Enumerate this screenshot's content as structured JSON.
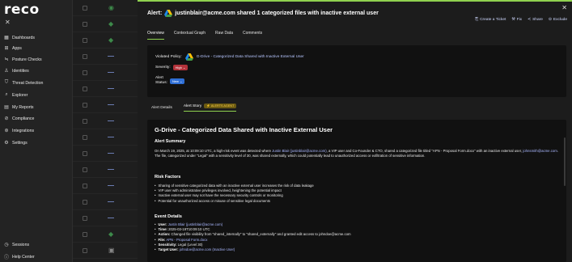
{
  "sidebar": {
    "logo": "reco",
    "items": [
      {
        "label": "Dashboards",
        "icon": "grid-icon"
      },
      {
        "label": "Apps",
        "icon": "apps-icon"
      },
      {
        "label": "Posture Checks",
        "icon": "posture-icon"
      },
      {
        "label": "Identities",
        "icon": "user-icon"
      },
      {
        "label": "Threat Detection",
        "icon": "shield-icon"
      },
      {
        "label": "Explorer",
        "icon": "explorer-icon"
      },
      {
        "label": "My Reports",
        "icon": "report-icon"
      },
      {
        "label": "Compliance",
        "icon": "check-icon"
      },
      {
        "label": "Integrations",
        "icon": "integration-icon"
      },
      {
        "label": "Settings",
        "icon": "gear-icon"
      }
    ],
    "bottom": [
      {
        "label": "Sessions",
        "icon": "clock-icon"
      },
      {
        "label": "Help Center",
        "icon": "help-icon"
      }
    ]
  },
  "alert": {
    "title_prefix": "Alert:",
    "title_text": "justinblair@acme.com shared 1 categorized files with inactive external user",
    "actions": [
      "Create a Ticket",
      "Fix",
      "Share",
      "Exclude"
    ],
    "tabs": [
      "Overview",
      "Contextual Graph",
      "Raw Data",
      "Comments"
    ],
    "violated_policy_label": "Violated Policy:",
    "violated_policy_value": "G-Drive - Categorized Data Shared with Inactive External User",
    "severity_label": "Severity:",
    "severity_value": "High",
    "status_label_1": "Alert",
    "status_label_2": "Status:",
    "status_value": "New",
    "subtabs": [
      "Alert Details",
      "Alert Story"
    ],
    "subtab_badge": "ALERTS AGENT"
  },
  "story": {
    "heading": "G-Drive - Categorized Data Shared with Inactive External User",
    "summary_title": "Alert Summary",
    "summary_1": "On March 19, 2025, at 10:09:10 UTC, a high-risk event was detected where ",
    "summary_user": "Justin Blair (justinblair@acme.com)",
    "summary_2": ", a VIP user and Co-Founder & CTO, shared a categorized file titled \"APN - Proposal Form.docx\" with an inactive external user, ",
    "summary_ext": "johnsmith@acme.com",
    "summary_3": ". The file, categorized under \"Legal\" with a sensitivity level of 30, was shared externally, which could potentially lead to unauthorized access or exfiltration of sensitive information.",
    "risk_title": "Risk Factors",
    "risks": [
      "Sharing of sensitive categorized data with an inactive external user increases the risk of data leakage",
      "VIP user with administrative privileges involved, heightening the potential impact",
      "Inactive external user may not have the necessary security controls or monitoring",
      "Potential for unauthorized access or misuse of sensitive legal documents"
    ],
    "event_title": "Event Details",
    "events": [
      {
        "k": "User:",
        "v": "Justin Blair (justinblair@acme.com)",
        "hl": true
      },
      {
        "k": "Time:",
        "v": "2025-03-19T10:09:10 UTC",
        "hl": false
      },
      {
        "k": "Action:",
        "v": "Changed file visibility from \"shared_internally\" to \"shared_externally\" and granted edit access to johndoe@acme.com",
        "hl": false
      },
      {
        "k": "File:",
        "v": "APN - Proposal Form.docx",
        "hl": true
      },
      {
        "k": "Sensitivity:",
        "v": "Legal (Level 30)",
        "hl": false
      },
      {
        "k": "Target User:",
        "v": "johndoe@acme.com (Inactive User)",
        "hl": false
      }
    ]
  },
  "colors": {
    "accent": "#8fd14f",
    "high": "#b3323a",
    "new": "#2f6fd6",
    "link": "#aab8ff"
  }
}
